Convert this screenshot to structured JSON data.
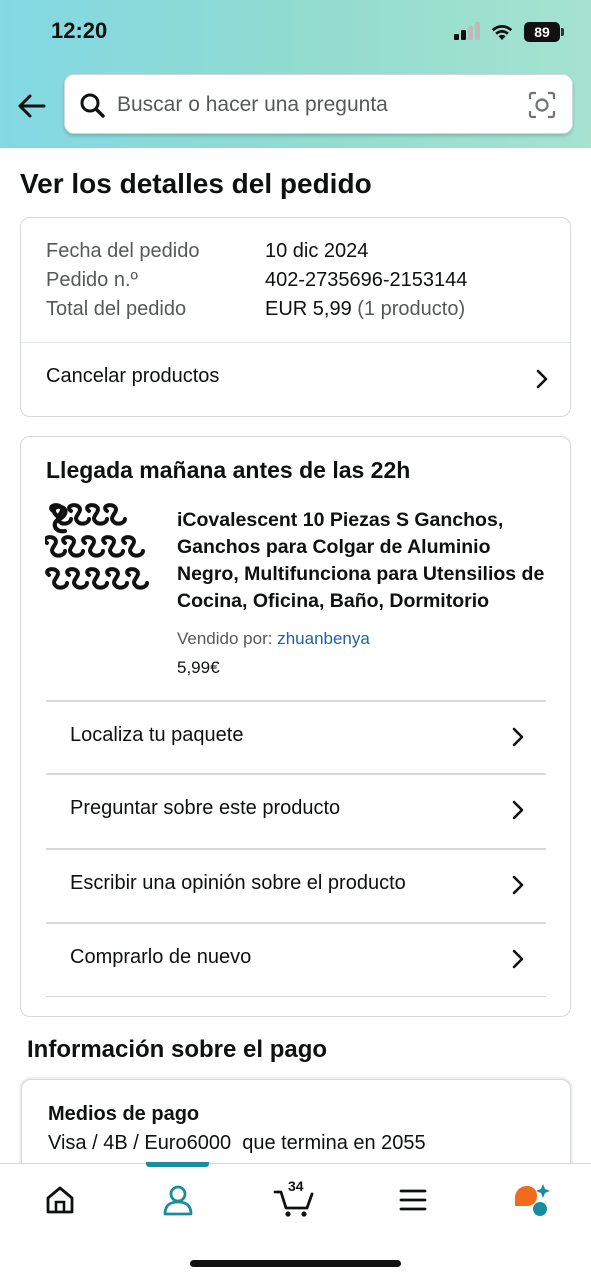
{
  "status_bar": {
    "time": "12:20",
    "battery": "89"
  },
  "search": {
    "placeholder": "Buscar o hacer una pregunta"
  },
  "page": {
    "title": "Ver los detalles del pedido"
  },
  "order_summary": {
    "date_label": "Fecha del pedido",
    "date_value": "10 dic 2024",
    "number_label": "Pedido n.º",
    "number_value": "402-2735696-2153144",
    "total_label": "Total del pedido",
    "total_value": "EUR 5,99",
    "total_count": "(1 producto)",
    "cancel_label": "Cancelar productos"
  },
  "delivery": {
    "title": "Llegada mañana antes de las 22h",
    "product": {
      "title": "iCovalescent 10 Piezas S Ganchos, Ganchos para Colgar de Aluminio Negro, Multifunciona para Utensilios de Cocina, Oficina, Baño, Dormitorio",
      "sold_by_label": "Vendido por:",
      "seller": "zhuanbenya",
      "price": "5,99€"
    },
    "actions": [
      {
        "label": "Localiza tu paquete"
      },
      {
        "label": "Preguntar sobre este producto"
      },
      {
        "label": "Escribir una opinión sobre el producto"
      },
      {
        "label": "Comprarlo de nuevo"
      }
    ]
  },
  "payment": {
    "section_title": "Información sobre el pago",
    "method_label": "Medios de pago",
    "method_value": "Visa / 4B / Euro6000  que termina en 2055"
  },
  "tabbar": {
    "cart_count": "34",
    "items": [
      "home-icon",
      "account-icon",
      "cart-icon",
      "menu-icon",
      "rufus-icon"
    ],
    "accent_color": "#1a8c9e"
  }
}
